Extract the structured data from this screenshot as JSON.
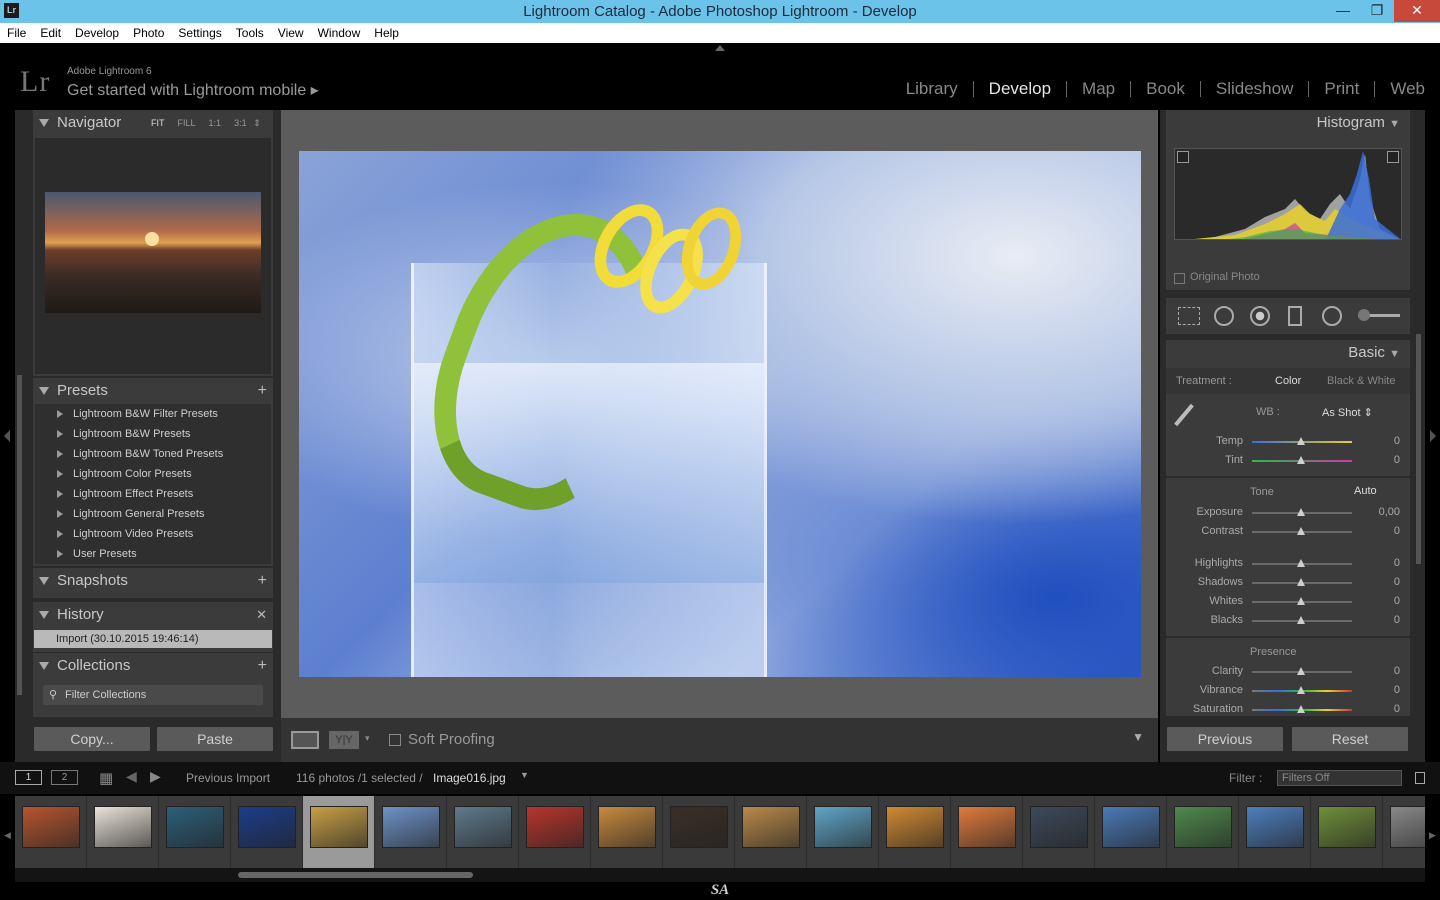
{
  "window": {
    "title": "Lightroom Catalog - Adobe Photoshop Lightroom - Develop",
    "app_icon": "Lr"
  },
  "menu": [
    "File",
    "Edit",
    "Develop",
    "Photo",
    "Settings",
    "Tools",
    "View",
    "Window",
    "Help"
  ],
  "identity": {
    "logo": "Lr",
    "product": "Adobe Lightroom 6",
    "tagline": "Get started with Lightroom mobile ▸"
  },
  "modules": [
    {
      "label": "Library",
      "active": false
    },
    {
      "label": "Develop",
      "active": true
    },
    {
      "label": "Map",
      "active": false
    },
    {
      "label": "Book",
      "active": false
    },
    {
      "label": "Slideshow",
      "active": false
    },
    {
      "label": "Print",
      "active": false
    },
    {
      "label": "Web",
      "active": false
    }
  ],
  "navigator": {
    "title": "Navigator",
    "zoom_options": [
      "FIT",
      "FILL",
      "1:1",
      "3:1 ⇕"
    ]
  },
  "presets": {
    "title": "Presets",
    "items": [
      "Lightroom B&W Filter Presets",
      "Lightroom B&W Presets",
      "Lightroom B&W Toned Presets",
      "Lightroom Color Presets",
      "Lightroom Effect Presets",
      "Lightroom General Presets",
      "Lightroom Video Presets",
      "User Presets"
    ]
  },
  "snapshots": {
    "title": "Snapshots"
  },
  "history": {
    "title": "History",
    "items": [
      "Import (30.10.2015 19:46:14)"
    ]
  },
  "collections": {
    "title": "Collections",
    "filter_placeholder": "Filter Collections"
  },
  "left_buttons": {
    "copy": "Copy...",
    "paste": "Paste"
  },
  "toolbar": {
    "soft_proofing": "Soft Proofing",
    "compare": "Y|Y"
  },
  "histogram": {
    "title": "Histogram",
    "original_photo": "Original Photo"
  },
  "basic": {
    "title": "Basic",
    "treatment_label": "Treatment :",
    "treatment_color": "Color",
    "treatment_bw": "Black & White",
    "wb_label": "WB :",
    "wb_value": "As Shot ⇕",
    "tone_label": "Tone",
    "auto": "Auto",
    "presence_label": "Presence",
    "wb_sliders": [
      {
        "name": "Temp",
        "value": "0"
      },
      {
        "name": "Tint",
        "value": "0"
      }
    ],
    "tone_sliders1": [
      {
        "name": "Exposure",
        "value": "0,00"
      },
      {
        "name": "Contrast",
        "value": "0"
      }
    ],
    "tone_sliders2": [
      {
        "name": "Highlights",
        "value": "0"
      },
      {
        "name": "Shadows",
        "value": "0"
      },
      {
        "name": "Whites",
        "value": "0"
      },
      {
        "name": "Blacks",
        "value": "0"
      }
    ],
    "presence_sliders": [
      {
        "name": "Clarity",
        "value": "0"
      },
      {
        "name": "Vibrance",
        "value": "0"
      },
      {
        "name": "Saturation",
        "value": "0"
      }
    ]
  },
  "right_buttons": {
    "previous": "Previous",
    "reset": "Reset"
  },
  "filmstrip_bar": {
    "screen1": "1",
    "screen2": "2",
    "source": "Previous Import",
    "count": "116 photos /1 selected /",
    "filename": "Image016.jpg",
    "filter_label": "Filter :",
    "filter_value": "Filters Off"
  },
  "filmstrip": {
    "selected_index": 4,
    "thumbs": [
      "#b6552f",
      "#e9e3d8",
      "#2c5f7a",
      "#1b3d8a",
      "#c7a046",
      "#6d93c8",
      "#5f7a8c",
      "#b8352c",
      "#c88a3e",
      "#3a2f26",
      "#b98a4a",
      "#5fa5c8",
      "#d28a32",
      "#e07b3c",
      "#3c4a5a",
      "#4a7ab8",
      "#4f8a4c",
      "#4d7fbf",
      "#6f8f3a",
      "#888888"
    ]
  },
  "watermark": "SA"
}
